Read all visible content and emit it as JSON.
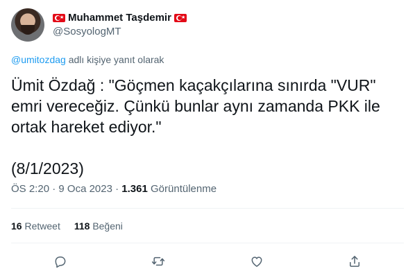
{
  "author": {
    "name": "Muhammet Taşdemir",
    "handle": "@SosyologMT"
  },
  "replying_to": {
    "mention": "@umitozdag",
    "suffix": " adlı kişiye yanıt olarak"
  },
  "tweet": {
    "text": "Ümit Özdağ : \"Göçmen kaçakçılarına sınırda \"VUR\" emri vereceğiz. Çünkü bunlar aynı zamanda PKK ile ortak hareket ediyor.\"\n\n(8/1/2023)"
  },
  "meta": {
    "time": "ÖS 2:20",
    "separator": "·",
    "date": "9 Oca 2023",
    "views": "1.361",
    "views_label": "Görüntülenme"
  },
  "stats": {
    "retweets": "16",
    "retweets_label": "Retweet",
    "likes": "118",
    "likes_label": "Beğeni"
  },
  "icons": {
    "reply": "reply-icon",
    "retweet": "retweet-icon",
    "like": "heart-icon",
    "share": "share-icon"
  },
  "colors": {
    "accent": "#1d9bf0",
    "secondary_text": "#536471",
    "flag_red": "#e30a17"
  }
}
